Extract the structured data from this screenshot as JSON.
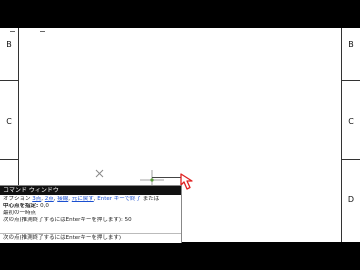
{
  "ruler_left": {
    "labels": [
      "B",
      "C"
    ]
  },
  "ruler_right": {
    "labels": [
      "B",
      "C",
      "D"
    ]
  },
  "command_window": {
    "title": "コマンド ウィンドウ",
    "options_prefix": "オプション ",
    "options": [
      "3点",
      "2点",
      "接線",
      "元に戻す"
    ],
    "enter_text": "Enter キーで終了",
    "enter_suffix": " または",
    "line2": "中心点を指定: ",
    "line2_value": "0,0",
    "line3": "最初の一時点",
    "line4": "次の点(推測終了するにはEnterキーを押します): 50",
    "input_line": "次の点(推測終了するにはEnterキーを押します)"
  }
}
